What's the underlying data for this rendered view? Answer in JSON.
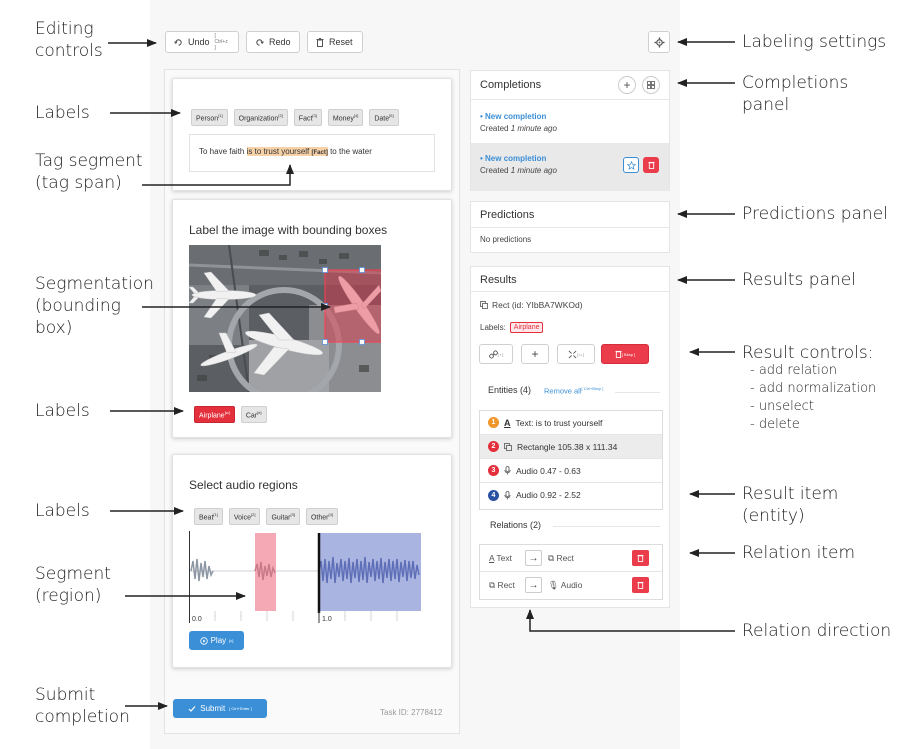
{
  "toolbar": {
    "undo_label": "Undo",
    "undo_shortcut": "[ Ctrl+z ]",
    "redo_label": "Redo",
    "reset_label": "Reset"
  },
  "text_task": {
    "labels": [
      {
        "name": "Person",
        "key": "[1]"
      },
      {
        "name": "Organization",
        "key": "[2]"
      },
      {
        "name": "Fact",
        "key": "[3]"
      },
      {
        "name": "Money",
        "key": "[4]"
      },
      {
        "name": "Date",
        "key": "[5]"
      }
    ],
    "text_before": "To have faith ",
    "text_highlight": "is to trust yourself",
    "highlight_tag": "[Fact]",
    "text_after": " to the water"
  },
  "image_task": {
    "title": "Label the image with bounding boxes",
    "labels": [
      {
        "name": "Airplane",
        "key": "[w]"
      },
      {
        "name": "Car",
        "key": "[e]"
      }
    ]
  },
  "audio_task": {
    "title": "Select audio regions",
    "labels": [
      {
        "name": "Beat",
        "key": "[1]"
      },
      {
        "name": "Voice",
        "key": "[2]"
      },
      {
        "name": "Guitar",
        "key": "[3]"
      },
      {
        "name": "Other",
        "key": "[4]"
      }
    ],
    "tick_start": "0.0",
    "tick_mid": "1.0",
    "play_label": "Play",
    "play_key": "[c]"
  },
  "submit": {
    "label": "Submit",
    "shortcut": "[ Ctrl+Enter ]",
    "task_id": "Task ID: 2778412"
  },
  "completions": {
    "title": "Completions",
    "items": [
      {
        "title": "New completion",
        "created_prefix": "Created ",
        "created_time": "1 minute ago"
      },
      {
        "title": "New completion",
        "created_prefix": "Created ",
        "created_time": "1 minute ago"
      }
    ]
  },
  "predictions": {
    "title": "Predictions",
    "empty": "No predictions"
  },
  "results": {
    "title": "Results",
    "selected": "Rect (id: YIbBA7WKOd)",
    "labels_prefix": "Labels:",
    "selected_label": "Airplane",
    "relation_key": "[ r ]",
    "add_label": "+",
    "unselect_key": "[ u ]",
    "delete_key": "[ Bksp ]",
    "entities_title": "Entities (4)",
    "remove_all": "Remove all",
    "remove_all_key": "[ Ctrl+Bksp ]",
    "entities": [
      {
        "num": "1",
        "color": "#f0962b",
        "icon": "text",
        "text": "Text:  is to trust yourself"
      },
      {
        "num": "2",
        "color": "#e3303c",
        "icon": "rect",
        "text": "Rectangle 105.38 x 111.34"
      },
      {
        "num": "3",
        "color": "#e3303c",
        "icon": "audio",
        "text": "Audio 0.47 - 0.63"
      },
      {
        "num": "4",
        "color": "#2952a3",
        "icon": "audio",
        "text": "Audio 0.92 - 2.52"
      }
    ],
    "relations_title": "Relations (2)",
    "relations": [
      {
        "from": "Text",
        "to": "Rect"
      },
      {
        "from": "Rect",
        "to": "Audio"
      }
    ]
  },
  "annotations": {
    "editing_controls": [
      "Editing",
      "controls"
    ],
    "labeling_settings": "Labeling settings",
    "completions_panel": "Completions panel",
    "labels_1": "Labels",
    "tag_segment": [
      "Tag segment",
      "(tag span)"
    ],
    "segmentation": [
      "Segmentation",
      "(bounding",
      "box)"
    ],
    "labels_2": "Labels",
    "labels_3": "Labels",
    "segment_region": [
      "Segment",
      "(region)"
    ],
    "submit_completion": [
      "Submit",
      "completion"
    ],
    "predictions_panel": "Predictions panel",
    "results_panel": "Results panel",
    "result_controls": "Result controls:",
    "result_controls_items": [
      "- add relation",
      "- add normalization",
      "- unselect",
      "- delete"
    ],
    "result_item": "Result item (entity)",
    "relation_item": "Relation item",
    "relation_direction": "Relation direction"
  },
  "colors": {
    "accent_blue": "#3b8fd6",
    "red": "#e3303c",
    "highlight": "#f7d1a8",
    "region_red": "#f4a9b4",
    "region_blue": "#aab4e0"
  }
}
